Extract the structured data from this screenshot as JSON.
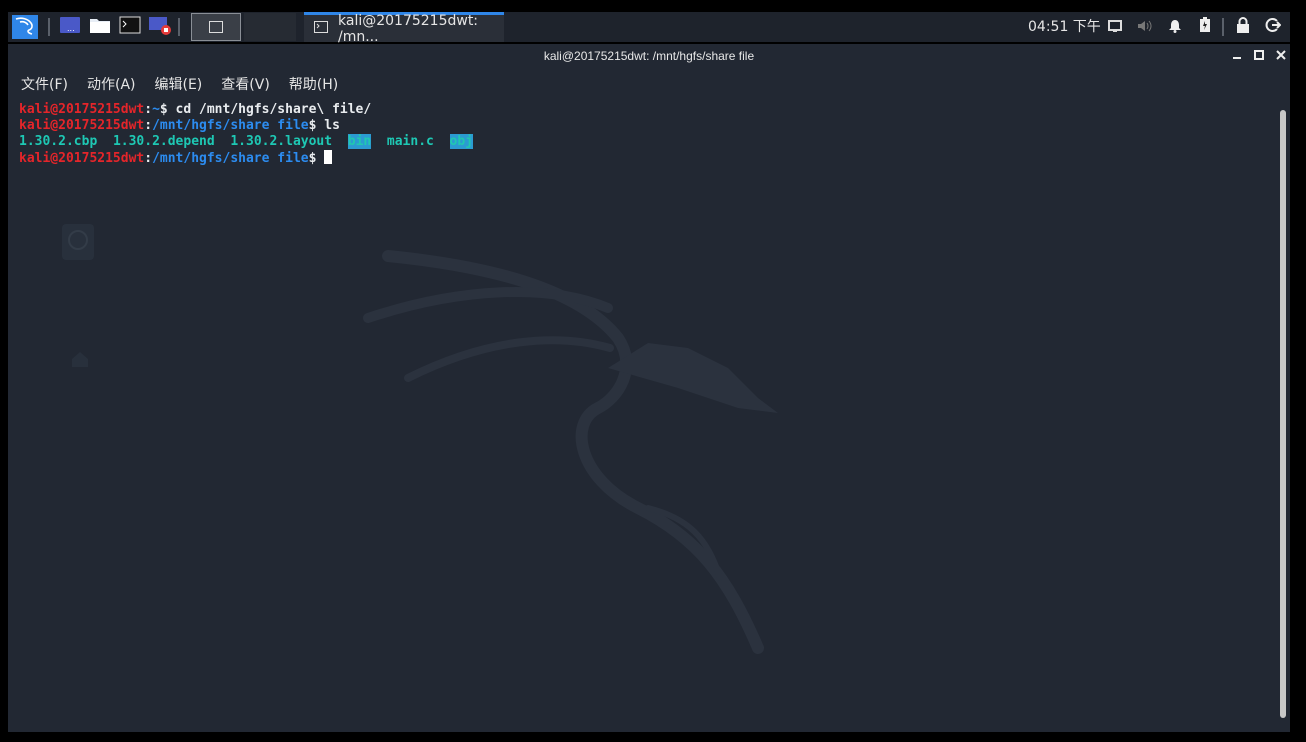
{
  "panel": {
    "task_title": "kali@20175215dwt: /mn...",
    "clock": "04:51 下午"
  },
  "window": {
    "title": "kali@20175215dwt: /mnt/hgfs/share file",
    "controls": [
      "minimize",
      "maximize",
      "close"
    ]
  },
  "menu": [
    {
      "label": "文件(F)"
    },
    {
      "label": "动作(A)"
    },
    {
      "label": "编辑(E)"
    },
    {
      "label": "查看(V)"
    },
    {
      "label": "帮助(H)"
    }
  ],
  "terminal": {
    "lines": [
      {
        "user": "kali@20175215dwt",
        "sep": ":",
        "path": "~",
        "prompt": "$ ",
        "cmd": "cd /mnt/hgfs/share\\ file/"
      },
      {
        "user": "kali@20175215dwt",
        "sep": ":",
        "path": "/mnt/hgfs/share file",
        "prompt": "$ ",
        "cmd": "ls"
      },
      {
        "ls": [
          "1.30.2.cbp",
          "1.30.2.depend",
          "1.30.2.layout",
          "bin",
          "main.c",
          "obj"
        ]
      },
      {
        "user": "kali@20175215dwt",
        "sep": ":",
        "path": "/mnt/hgfs/share file",
        "prompt": "$ ",
        "cmd": ""
      }
    ]
  },
  "icons": {
    "kali_menu": "kali-dragon-icon",
    "show_desktop": "show-desktop-icon",
    "files": "folder-icon",
    "terminal": "terminal-icon",
    "screen_recorder": "screen-recorder-icon",
    "volume": "volume-icon",
    "bell": "bell-icon",
    "battery": "battery-icon",
    "lock": "lock-icon",
    "logout": "logout-icon"
  },
  "colors": {
    "accent": "#2f86e8",
    "user": "#e5252a",
    "path": "#2c8cf0",
    "file": "#1ec8b4",
    "dir_bg": "#2b9bd1"
  }
}
